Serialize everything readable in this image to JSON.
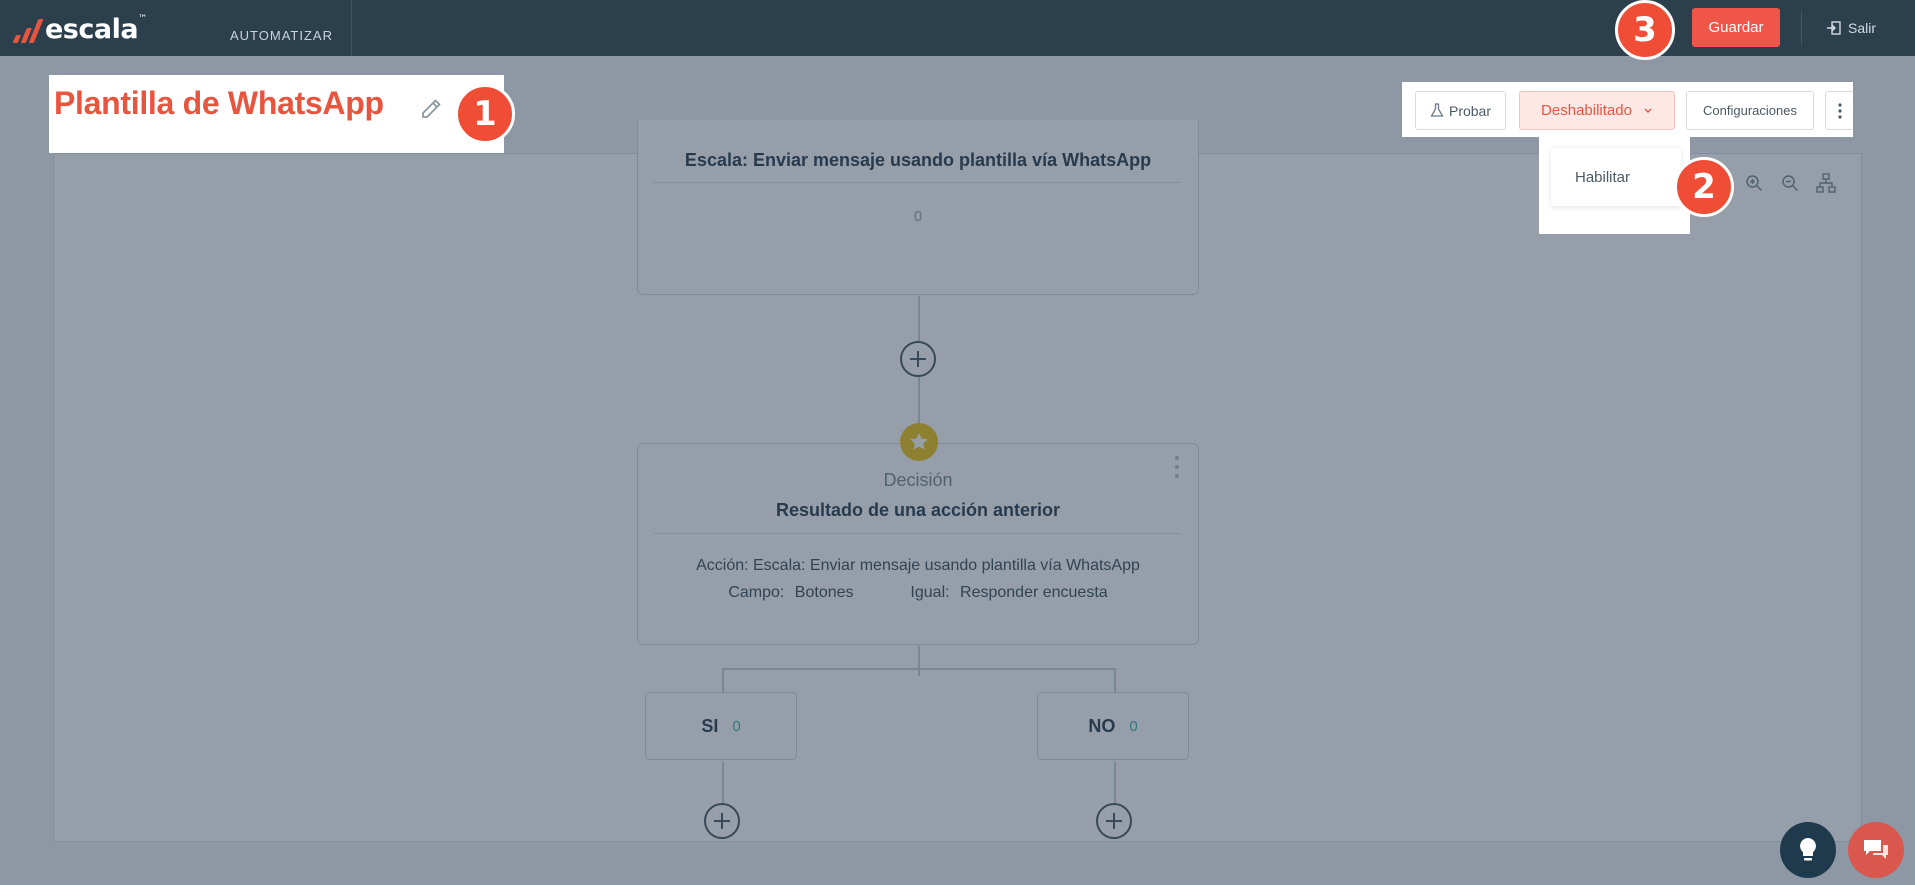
{
  "topbar": {
    "brand": "escala",
    "brand_tm": "™",
    "nav_label": "AUTOMATIZAR",
    "save_label": "Guardar",
    "logout_label": "Salir"
  },
  "header": {
    "title": "Plantilla de WhatsApp",
    "test_label": "Probar",
    "status_label": "Deshabilitado",
    "settings_label": "Configuraciones",
    "status_menu": [
      "Habilitar"
    ]
  },
  "flow": {
    "action_node": {
      "title": "Escala: Enviar mensaje usando plantilla vía WhatsApp",
      "count": "0"
    },
    "decision_node": {
      "type": "Decisión",
      "title": "Resultado de una acción anterior",
      "action_text": "Acción: Escala: Enviar mensaje usando plantilla vía WhatsApp",
      "field_label": "Campo:",
      "field_value": "Botones",
      "equals_label": "Igual:",
      "equals_value": "Responder encuesta"
    },
    "branches": [
      {
        "label": "SI",
        "count": "0"
      },
      {
        "label": "NO",
        "count": "0"
      }
    ]
  },
  "markers": [
    "1",
    "2",
    "3"
  ],
  "colors": {
    "brand": "#e8553f",
    "topbar": "#2c3f4d",
    "marker": "#ef4d35",
    "decision_badge": "#f0c419",
    "branch_count": "#3bb3b3"
  },
  "icons": {
    "edit": "pencil-icon",
    "test": "flask-icon",
    "status": "chevron-down-icon",
    "more": "kebab-icon",
    "logout": "sign-out-icon",
    "zoom_in": "zoom-in-icon",
    "zoom_out": "zoom-out-icon",
    "layout": "org-chart-icon",
    "decision": "star-icon",
    "add": "plus-circle-icon",
    "tips": "lightbulb-icon",
    "chat": "chat-icon"
  }
}
